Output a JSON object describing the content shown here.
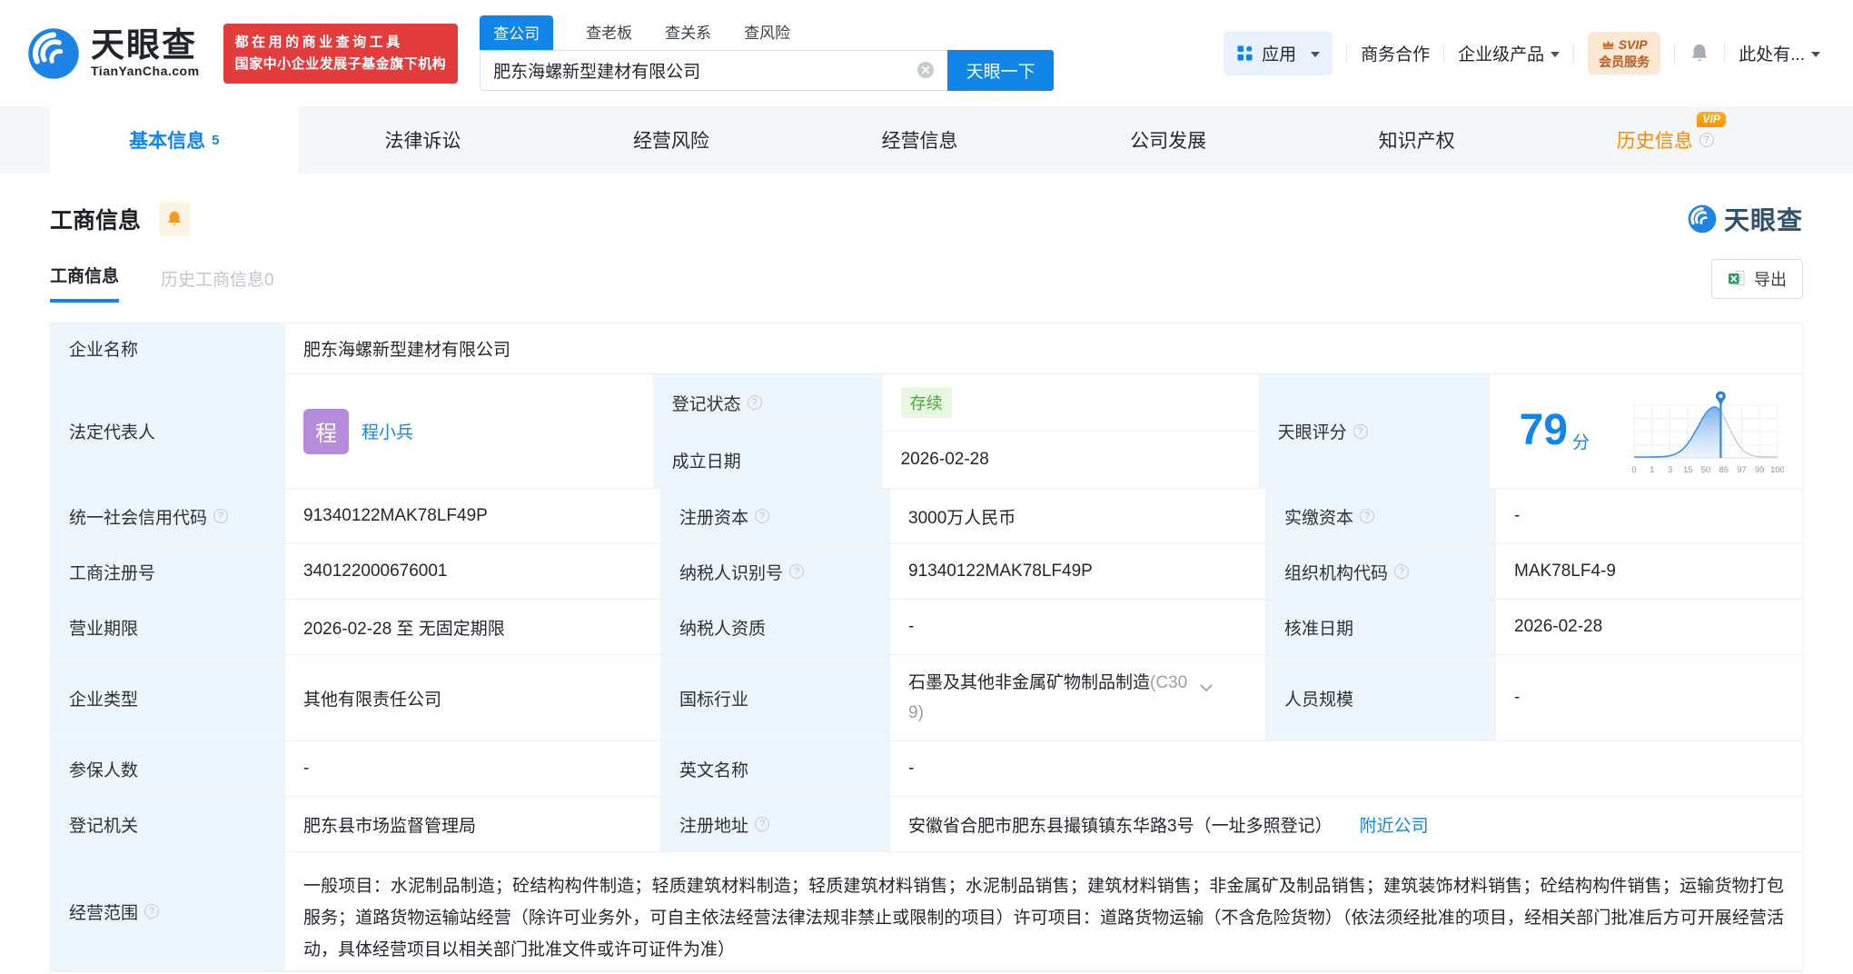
{
  "colors": {
    "accent_blue": "#1285e8",
    "promo_red": "#e23c3c",
    "history_orange": "#ff8a00",
    "status_green": "#3fae27",
    "avatar_purple": "#b68bd9",
    "label_bg": "#eef6fd",
    "svip_orange": "#bd5b1e"
  },
  "icons": {
    "question": "?",
    "clear": "×",
    "bell": "bell",
    "excel": "excel-export",
    "app_grid": "grid",
    "location_pin": "pin",
    "chevron_down": "v"
  },
  "header": {
    "brand": "天眼查",
    "brand_domain": "TianYanCha.com",
    "promo_line1": "都在用的商业查询工具",
    "promo_line2": "国家中小企业发展子基金旗下机构",
    "search_tabs": [
      {
        "label": "查公司"
      },
      {
        "label": "查老板"
      },
      {
        "label": "查关系"
      },
      {
        "label": "查风险"
      }
    ],
    "search_value": "肥东海螺新型建材有限公司",
    "search_button": "天眼一下",
    "nav_apps": "应用",
    "nav_cooperation": "商务合作",
    "nav_enterprise": "企业级产品",
    "svip_top": "SVIP",
    "svip_bottom": "会员服务",
    "nav_user": "此处有..."
  },
  "main_tabs": [
    {
      "label": "基本信息",
      "count": "5"
    },
    {
      "label": "法律诉讼"
    },
    {
      "label": "经营风险"
    },
    {
      "label": "经营信息"
    },
    {
      "label": "公司发展"
    },
    {
      "label": "知识产权"
    },
    {
      "label": "历史信息",
      "vip": "VIP"
    }
  ],
  "section": {
    "title": "工商信息",
    "subtab_current": "工商信息",
    "subtab_history": "历史工商信息",
    "subtab_history_count": "0",
    "export_label": "导出",
    "watermark": "天眼查"
  },
  "fields": {
    "name_label": "企业名称",
    "name": "肥东海螺新型建材有限公司",
    "legal_label": "法定代表人",
    "legal_avatar": "程",
    "legal_name": "程小兵",
    "status_label": "登记状态",
    "status": "存续",
    "establish_label": "成立日期",
    "establish": "2026-02-28",
    "score_label": "天眼评分",
    "uscc_label": "统一社会信用代码",
    "uscc": "91340122MAK78LF49P",
    "capital_label": "注册资本",
    "capital": "3000万人民币",
    "paid_label": "实缴资本",
    "paid": "-",
    "regno_label": "工商注册号",
    "regno": "340122000676001",
    "taxid_label": "纳税人识别号",
    "taxid": "91340122MAK78LF49P",
    "orgcode_label": "组织机构代码",
    "orgcode": "MAK78LF4-9",
    "term_label": "营业期限",
    "term": "2026-02-28 至 无固定期限",
    "taxqual_label": "纳税人资质",
    "taxqual": "-",
    "approve_label": "核准日期",
    "approve": "2026-02-28",
    "type_label": "企业类型",
    "type": "其他有限责任公司",
    "industry_label": "国标行业",
    "industry": "石墨及其他非金属矿物制品制造",
    "industry_code": "(C309)",
    "staff_label": "人员规模",
    "staff": "-",
    "insured_label": "参保人数",
    "insured": "-",
    "enname_label": "英文名称",
    "enname": "-",
    "authority_label": "登记机关",
    "authority": "肥东县市场监督管理局",
    "address_label": "注册地址",
    "address": "安徽省合肥市肥东县撮镇镇东华路3号（一址多照登记）",
    "nearby": "附近公司",
    "scope_label": "经营范围",
    "scope": "一般项目：水泥制品制造；砼结构构件制造；轻质建筑材料制造；轻质建筑材料销售；水泥制品销售；建筑材料销售；非金属矿及制品销售；建筑装饰材料销售；砼结构构件销售；运输货物打包服务；道路货物运输站经营（除许可业务外，可自主依法经营法律法规非禁止或限制的项目）许可项目：道路货物运输（不含危险货物）（依法须经批准的项目，经相关部门批准后方可开展经营活动，具体经营项目以相关部门批准文件或许可证件为准）"
  },
  "chart_data": {
    "type": "area",
    "title": "天眼评分",
    "score": 79,
    "score_unit": "分",
    "x_ticks": [
      "0",
      "1",
      "3",
      "15",
      "50",
      "85",
      "97",
      "99",
      "100"
    ],
    "marker_value": 79,
    "curve_peak": 0.56,
    "curve_sigma_left": 0.115,
    "curve_sigma_right": 0.1,
    "line_color": "#3f8ee8",
    "tail_color": "#c6ccd4",
    "grid": true
  }
}
